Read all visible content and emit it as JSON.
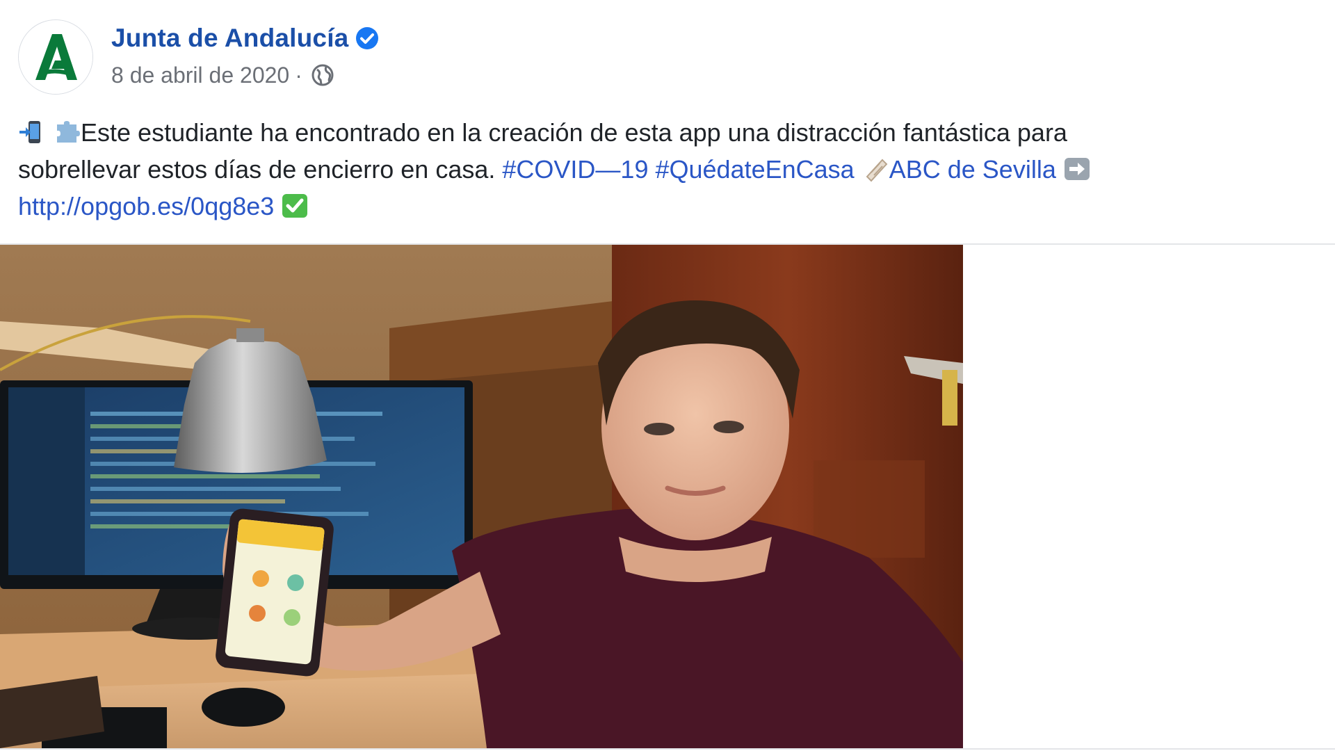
{
  "post": {
    "author": {
      "name": "Junta de Andalucía",
      "verified": true,
      "avatar_icon": "junta-andalucia-logo-icon",
      "brand_color": "#0a7a3a"
    },
    "date": "8 de abril de 2020",
    "separator": "·",
    "audience_icon": "globe-icon",
    "text": {
      "line1": "Este estudiante ha encontrado en la creación de esta app una distracción fantástica para",
      "line2": "sobrellevar estos días de encierro en casa.",
      "hashtag1": "#COVID—19",
      "hashtag2": "#QuédateEnCasa",
      "source_link": "ABC de Sevilla",
      "url": "http://opgob.es/0qg8e3",
      "emojis": [
        "mobile-phone-arrow-icon",
        "puzzle-piece-icon",
        "newspaper-roll-icon",
        "right-arrow-icon",
        "check-mark-button-icon"
      ]
    },
    "photo": {
      "subject": "student-holding-smartphone-photo"
    },
    "colors": {
      "link": "#2a56c6",
      "name": "#1b4fa8",
      "meta": "#6b6f76",
      "verified": "#1877f2"
    }
  }
}
